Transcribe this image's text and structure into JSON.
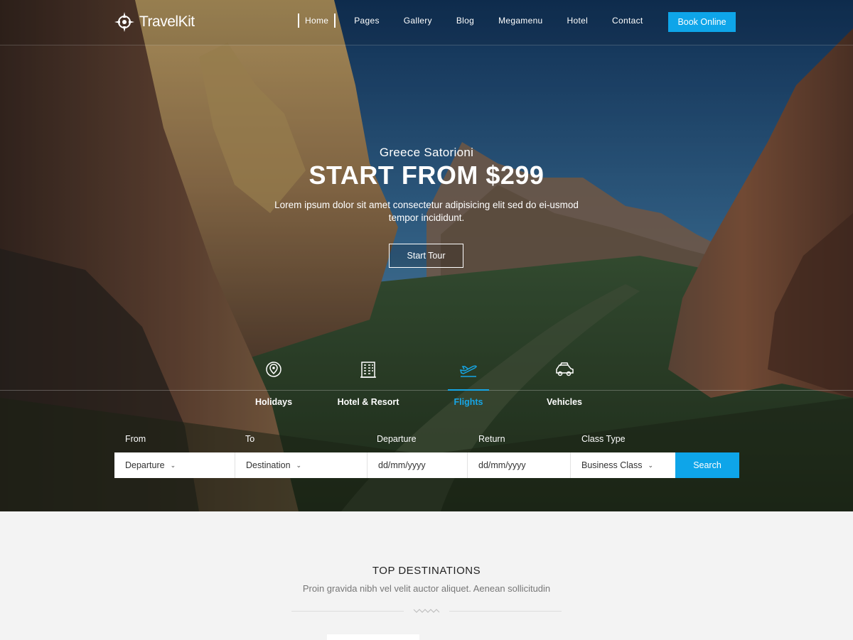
{
  "brand": {
    "name": "TravelKit"
  },
  "nav": {
    "items": [
      "Home",
      "Pages",
      "Gallery",
      "Blog",
      "Megamenu",
      "Hotel",
      "Contact"
    ],
    "active": "Home",
    "cta": "Book Online"
  },
  "hero": {
    "subtitle": "Greece Satorioni",
    "title": "START FROM $299",
    "description": "Lorem ipsum dolor sit amet consectetur adipisicing elit sed do ei-usmod tempor incididunt.",
    "button": "Start Tour"
  },
  "tabs": {
    "items": [
      {
        "label": "Holidays",
        "icon": "map-pin-icon"
      },
      {
        "label": "Hotel & Resort",
        "icon": "building-icon"
      },
      {
        "label": "Flights",
        "icon": "airplane-icon"
      },
      {
        "label": "Vehicles",
        "icon": "car-icon"
      }
    ],
    "active": "Flights"
  },
  "search_form": {
    "labels": {
      "from": "From",
      "to": "To",
      "departure": "Departure",
      "return": "Return",
      "class": "Class Type"
    },
    "values": {
      "from": "Departure",
      "to": "Destination",
      "departure": "dd/mm/yyyy",
      "return": "dd/mm/yyyy",
      "class": "Business Class"
    },
    "button": "Search"
  },
  "destinations": {
    "title": "TOP DESTINATIONS",
    "subtitle": "Proin gravida nibh vel velit auctor aliquet. Aenean sollicitudin"
  },
  "colors": {
    "accent": "#0ea5e9",
    "active_tab": "#16a6e6"
  }
}
